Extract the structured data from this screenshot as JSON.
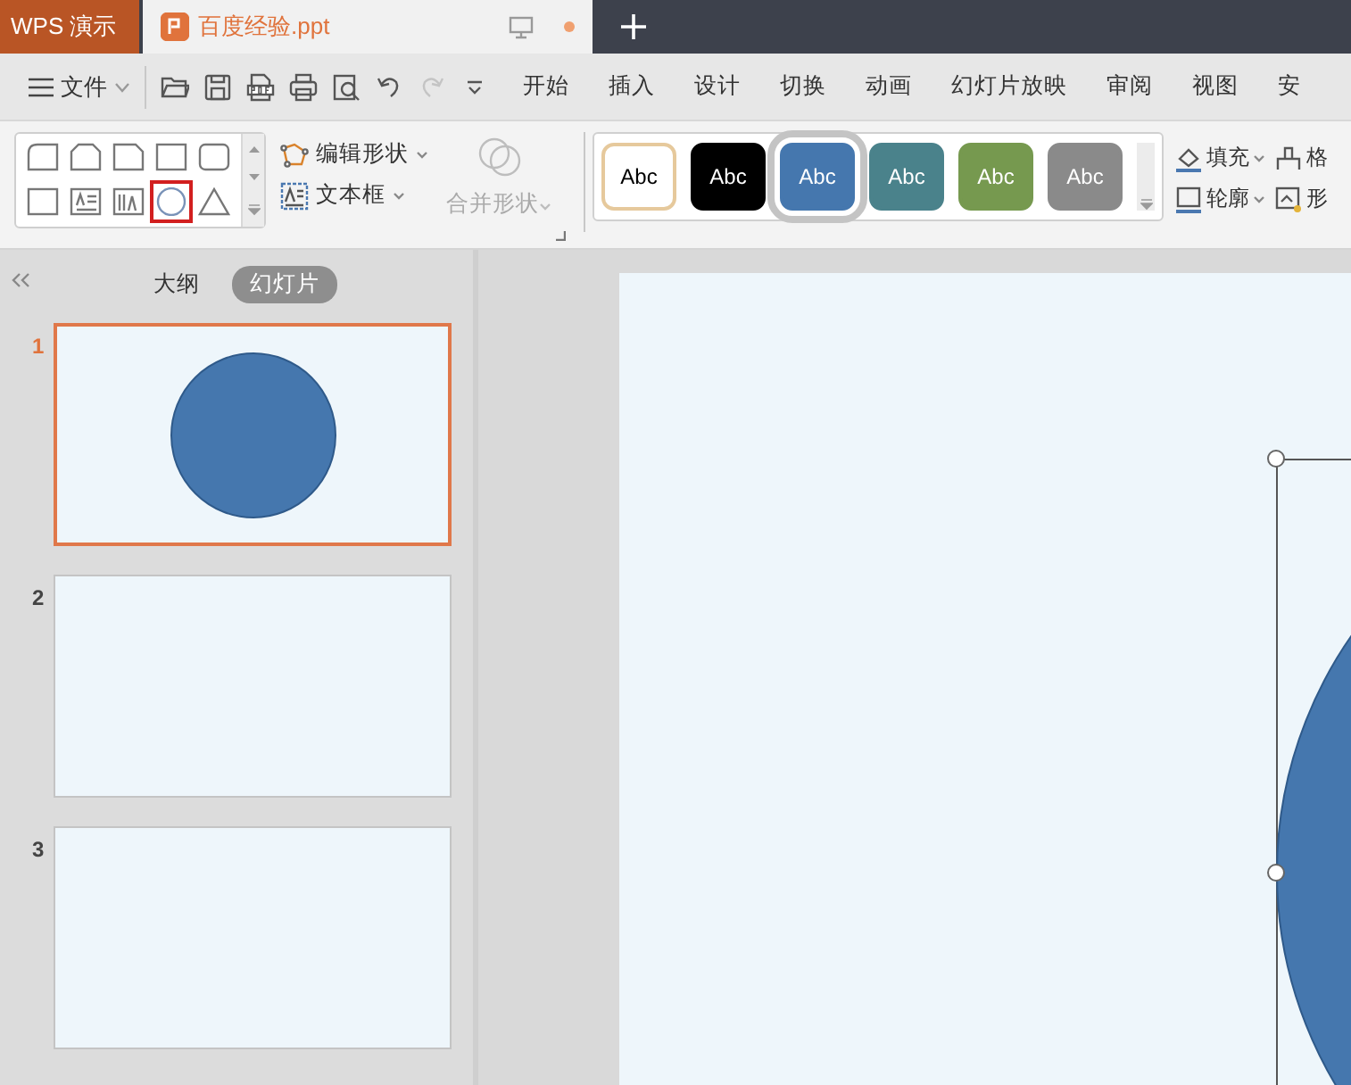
{
  "app_tab": {
    "label": "WPS 演示"
  },
  "document_tab": {
    "name": "百度经验.ppt",
    "modified": true
  },
  "file_menu": {
    "label": "文件"
  },
  "quick_actions": [
    {
      "kind": "open",
      "disabled": false
    },
    {
      "kind": "save",
      "disabled": false
    },
    {
      "kind": "pdf",
      "disabled": false
    },
    {
      "kind": "print",
      "disabled": false
    },
    {
      "kind": "preview",
      "disabled": false
    },
    {
      "kind": "undo",
      "disabled": false
    },
    {
      "kind": "redo",
      "disabled": true
    },
    {
      "kind": "more",
      "disabled": false
    }
  ],
  "menu_tabs": [
    {
      "label": "开始",
      "selected": false
    },
    {
      "label": "插入",
      "selected": false
    },
    {
      "label": "设计",
      "selected": false
    },
    {
      "label": "切换",
      "selected": false
    },
    {
      "label": "动画",
      "selected": false
    },
    {
      "label": "幻灯片放映",
      "selected": false
    },
    {
      "label": "审阅",
      "selected": false
    },
    {
      "label": "视图",
      "selected": false
    },
    {
      "label": "安",
      "selected": false
    }
  ],
  "shape_gallery": [
    {
      "kind": "round-corner",
      "selected": false
    },
    {
      "kind": "snip-corners",
      "selected": false
    },
    {
      "kind": "snip-corner",
      "selected": false
    },
    {
      "kind": "rect",
      "selected": false
    },
    {
      "kind": "rounded-rect",
      "selected": false
    },
    {
      "kind": "rect",
      "selected": false
    },
    {
      "kind": "text-box",
      "selected": false
    },
    {
      "kind": "vertical-text-box",
      "selected": false
    },
    {
      "kind": "ellipse",
      "selected": true
    },
    {
      "kind": "triangle",
      "selected": false
    }
  ],
  "edit_shape": {
    "label": "编辑形状"
  },
  "text_box": {
    "label": "文本框"
  },
  "merge_shapes": {
    "label": "合并形状",
    "disabled": true
  },
  "style_gallery": [
    {
      "label": "Abc",
      "kind": "outline",
      "color": "#e6c99c",
      "selected": false
    },
    {
      "label": "Abc",
      "kind": "filled",
      "color": "#000000",
      "selected": false
    },
    {
      "label": "Abc",
      "kind": "filled",
      "color": "#4577ae",
      "selected": true
    },
    {
      "label": "Abc",
      "kind": "filled",
      "color": "#4a828b",
      "selected": false
    },
    {
      "label": "Abc",
      "kind": "filled",
      "color": "#76994f",
      "selected": false
    },
    {
      "label": "Abc",
      "kind": "filled",
      "color": "#8a8a8a",
      "selected": false
    }
  ],
  "format_tools": [
    {
      "kind": "fill",
      "label": "填充",
      "dropdown": true
    },
    {
      "kind": "format",
      "label": "格",
      "dropdown": false
    },
    {
      "kind": "outline",
      "label": "轮廓",
      "dropdown": true
    },
    {
      "kind": "effects",
      "label": "形",
      "dropdown": false
    }
  ],
  "panel_tabs": [
    {
      "label": "大纲",
      "selected": false
    },
    {
      "label": "幻灯片",
      "selected": true
    }
  ],
  "slides": [
    {
      "number": "1",
      "selected": true,
      "shapes": [
        {
          "kind": "circle"
        }
      ]
    },
    {
      "number": "2",
      "selected": false
    },
    {
      "number": "3",
      "selected": false
    }
  ],
  "canvas": {
    "shapes": [
      {
        "kind": "circle",
        "selected": true
      }
    ]
  }
}
